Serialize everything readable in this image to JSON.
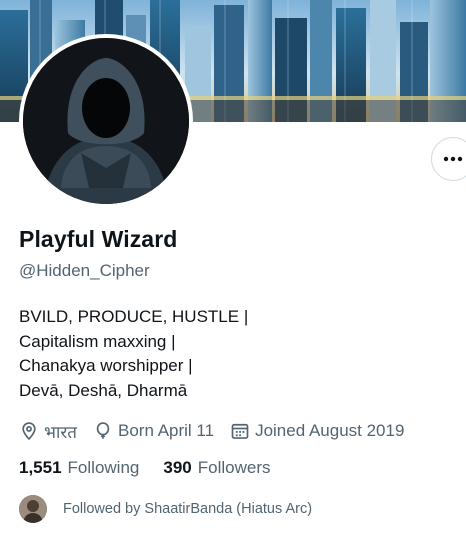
{
  "profile": {
    "name": "Playful Wizard",
    "handle": "@Hidden_Cipher",
    "bio_lines": [
      "BVILD, PRODUCE, HUSTLE |",
      "Capitalism maxxing |",
      "Chanakya worshipper |",
      "Devā, Deshā, Dharmā"
    ]
  },
  "meta": {
    "location": "भारत",
    "birthday": "Born April 11",
    "joined": "Joined August 2019"
  },
  "counts": {
    "following_value": "1,551",
    "following_label": "Following",
    "followers_value": "390",
    "followers_label": "Followers"
  },
  "followed_by": "Followed by ShaatirBanda (Hiatus Arc)",
  "icons": {
    "more": "more-horizontal-icon",
    "location": "location-pin-icon",
    "birthday": "balloon-icon",
    "joined": "calendar-icon"
  },
  "colors": {
    "text_primary": "#0f1419",
    "text_secondary": "#536471",
    "border": "#cfd9de"
  }
}
